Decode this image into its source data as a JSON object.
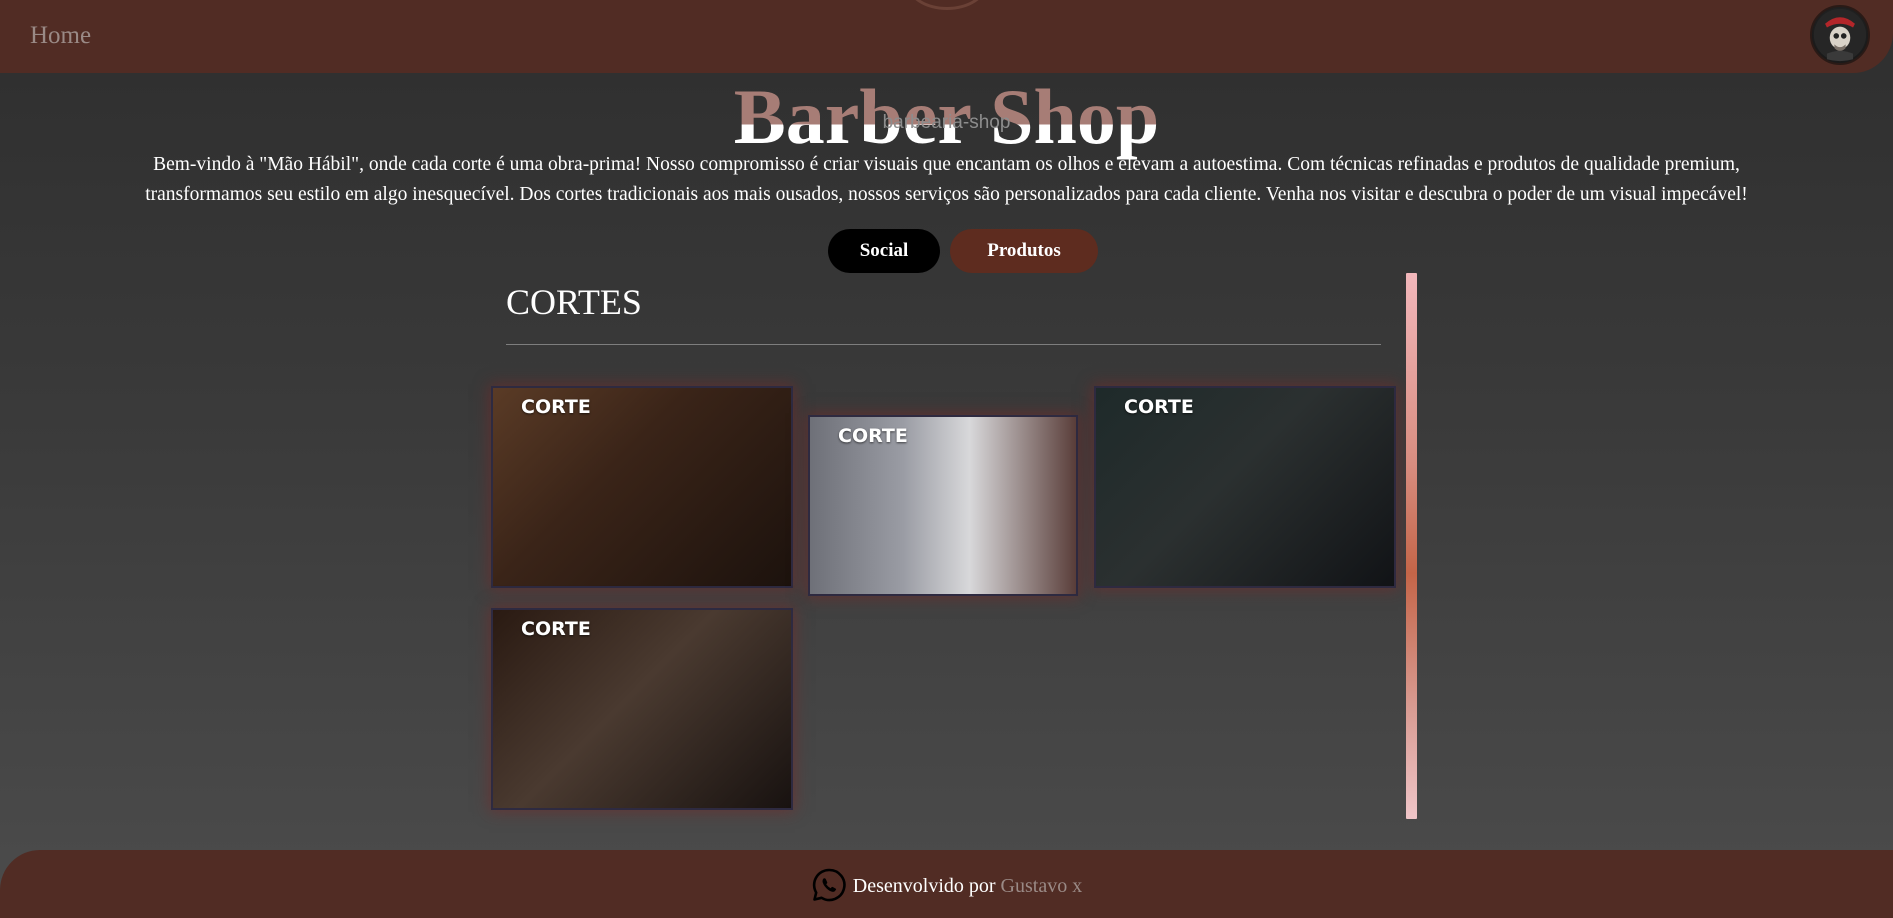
{
  "header": {
    "nav_home": "Home",
    "title": "Barber Shop",
    "subtitle": "barbearia-shop",
    "intro_line1": "Bem-vindo à \"Mão Hábil\", onde cada corte é uma obra-prima! Nosso compromisso é criar visuais que encantam os olhos e elevam a autoestima. Com técnicas refinadas e produtos de qualidade premium,",
    "intro_line2": "transformamos seu estilo em algo inesquecível. Dos cortes tradicionais aos mais ousados, nossos serviços são personalizados para cada cliente. Venha nos visitar e descubra o poder de um visual impecável!"
  },
  "tabs": [
    {
      "label": "Social"
    },
    {
      "label": "Produtos"
    }
  ],
  "gallery": {
    "title": "CORTES",
    "cards": [
      {
        "label": "CORTE"
      },
      {
        "label": "CORTE"
      },
      {
        "label": "CORTE"
      },
      {
        "label": "CORTE"
      }
    ]
  },
  "footer": {
    "prefix": "Desenvolvido por",
    "author": "Gustavo x"
  },
  "colors": {
    "header_bg": "#512c24",
    "footer_bg": "#512c24",
    "tab_social_bg": "#000000",
    "tab_produtos_bg": "#5e2c1f",
    "title_upper": "#a77d76",
    "link_muted": "#9a8a86"
  },
  "icons": {
    "avatar": "barber-skull-logo",
    "footer": "whatsapp-icon"
  }
}
